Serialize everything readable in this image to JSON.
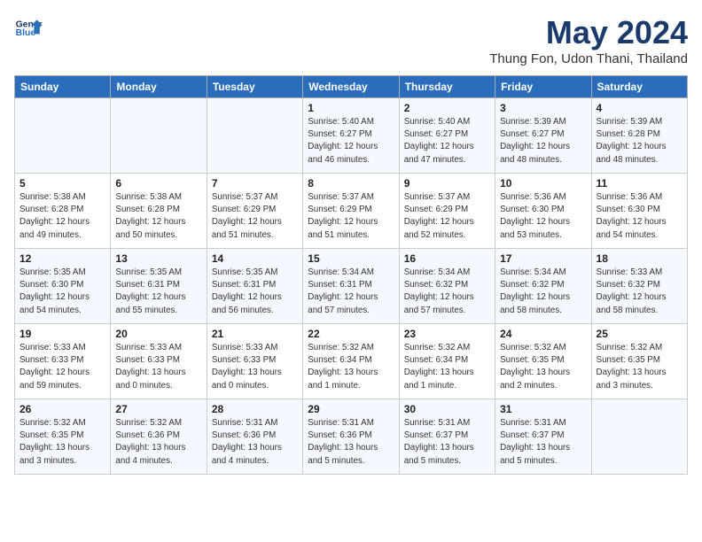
{
  "header": {
    "logo_line1": "General",
    "logo_line2": "Blue",
    "month_year": "May 2024",
    "location": "Thung Fon, Udon Thani, Thailand"
  },
  "days_of_week": [
    "Sunday",
    "Monday",
    "Tuesday",
    "Wednesday",
    "Thursday",
    "Friday",
    "Saturday"
  ],
  "weeks": [
    [
      {
        "day": "",
        "info": ""
      },
      {
        "day": "",
        "info": ""
      },
      {
        "day": "",
        "info": ""
      },
      {
        "day": "1",
        "info": "Sunrise: 5:40 AM\nSunset: 6:27 PM\nDaylight: 12 hours\nand 46 minutes."
      },
      {
        "day": "2",
        "info": "Sunrise: 5:40 AM\nSunset: 6:27 PM\nDaylight: 12 hours\nand 47 minutes."
      },
      {
        "day": "3",
        "info": "Sunrise: 5:39 AM\nSunset: 6:27 PM\nDaylight: 12 hours\nand 48 minutes."
      },
      {
        "day": "4",
        "info": "Sunrise: 5:39 AM\nSunset: 6:28 PM\nDaylight: 12 hours\nand 48 minutes."
      }
    ],
    [
      {
        "day": "5",
        "info": "Sunrise: 5:38 AM\nSunset: 6:28 PM\nDaylight: 12 hours\nand 49 minutes."
      },
      {
        "day": "6",
        "info": "Sunrise: 5:38 AM\nSunset: 6:28 PM\nDaylight: 12 hours\nand 50 minutes."
      },
      {
        "day": "7",
        "info": "Sunrise: 5:37 AM\nSunset: 6:29 PM\nDaylight: 12 hours\nand 51 minutes."
      },
      {
        "day": "8",
        "info": "Sunrise: 5:37 AM\nSunset: 6:29 PM\nDaylight: 12 hours\nand 51 minutes."
      },
      {
        "day": "9",
        "info": "Sunrise: 5:37 AM\nSunset: 6:29 PM\nDaylight: 12 hours\nand 52 minutes."
      },
      {
        "day": "10",
        "info": "Sunrise: 5:36 AM\nSunset: 6:30 PM\nDaylight: 12 hours\nand 53 minutes."
      },
      {
        "day": "11",
        "info": "Sunrise: 5:36 AM\nSunset: 6:30 PM\nDaylight: 12 hours\nand 54 minutes."
      }
    ],
    [
      {
        "day": "12",
        "info": "Sunrise: 5:35 AM\nSunset: 6:30 PM\nDaylight: 12 hours\nand 54 minutes."
      },
      {
        "day": "13",
        "info": "Sunrise: 5:35 AM\nSunset: 6:31 PM\nDaylight: 12 hours\nand 55 minutes."
      },
      {
        "day": "14",
        "info": "Sunrise: 5:35 AM\nSunset: 6:31 PM\nDaylight: 12 hours\nand 56 minutes."
      },
      {
        "day": "15",
        "info": "Sunrise: 5:34 AM\nSunset: 6:31 PM\nDaylight: 12 hours\nand 57 minutes."
      },
      {
        "day": "16",
        "info": "Sunrise: 5:34 AM\nSunset: 6:32 PM\nDaylight: 12 hours\nand 57 minutes."
      },
      {
        "day": "17",
        "info": "Sunrise: 5:34 AM\nSunset: 6:32 PM\nDaylight: 12 hours\nand 58 minutes."
      },
      {
        "day": "18",
        "info": "Sunrise: 5:33 AM\nSunset: 6:32 PM\nDaylight: 12 hours\nand 58 minutes."
      }
    ],
    [
      {
        "day": "19",
        "info": "Sunrise: 5:33 AM\nSunset: 6:33 PM\nDaylight: 12 hours\nand 59 minutes."
      },
      {
        "day": "20",
        "info": "Sunrise: 5:33 AM\nSunset: 6:33 PM\nDaylight: 13 hours\nand 0 minutes."
      },
      {
        "day": "21",
        "info": "Sunrise: 5:33 AM\nSunset: 6:33 PM\nDaylight: 13 hours\nand 0 minutes."
      },
      {
        "day": "22",
        "info": "Sunrise: 5:32 AM\nSunset: 6:34 PM\nDaylight: 13 hours\nand 1 minute."
      },
      {
        "day": "23",
        "info": "Sunrise: 5:32 AM\nSunset: 6:34 PM\nDaylight: 13 hours\nand 1 minute."
      },
      {
        "day": "24",
        "info": "Sunrise: 5:32 AM\nSunset: 6:35 PM\nDaylight: 13 hours\nand 2 minutes."
      },
      {
        "day": "25",
        "info": "Sunrise: 5:32 AM\nSunset: 6:35 PM\nDaylight: 13 hours\nand 3 minutes."
      }
    ],
    [
      {
        "day": "26",
        "info": "Sunrise: 5:32 AM\nSunset: 6:35 PM\nDaylight: 13 hours\nand 3 minutes."
      },
      {
        "day": "27",
        "info": "Sunrise: 5:32 AM\nSunset: 6:36 PM\nDaylight: 13 hours\nand 4 minutes."
      },
      {
        "day": "28",
        "info": "Sunrise: 5:31 AM\nSunset: 6:36 PM\nDaylight: 13 hours\nand 4 minutes."
      },
      {
        "day": "29",
        "info": "Sunrise: 5:31 AM\nSunset: 6:36 PM\nDaylight: 13 hours\nand 5 minutes."
      },
      {
        "day": "30",
        "info": "Sunrise: 5:31 AM\nSunset: 6:37 PM\nDaylight: 13 hours\nand 5 minutes."
      },
      {
        "day": "31",
        "info": "Sunrise: 5:31 AM\nSunset: 6:37 PM\nDaylight: 13 hours\nand 5 minutes."
      },
      {
        "day": "",
        "info": ""
      }
    ]
  ]
}
